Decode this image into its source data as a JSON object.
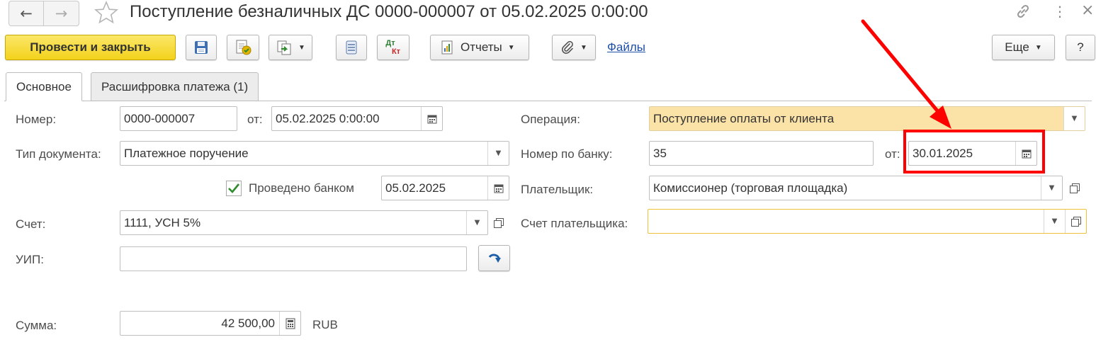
{
  "window": {
    "title": "Поступление безналичных ДС 0000-000007 от 05.02.2025 0:00:00",
    "link_glyph": "🔗",
    "more_glyph": "⋮",
    "close_glyph": "×"
  },
  "nav": {
    "back": "←",
    "forward": "→"
  },
  "toolbar": {
    "post_close": "Провести и закрыть",
    "reports": "Отчеты",
    "files": "Файлы",
    "more": "Еще",
    "help": "?",
    "dt": "Дт",
    "kt": "Кт"
  },
  "tabs": [
    {
      "label": "Основное",
      "active": true
    },
    {
      "label": "Расшифровка платежа (1)",
      "active": false
    }
  ],
  "form": {
    "number_label": "Номер:",
    "number_value": "0000-000007",
    "from_label": "от:",
    "date_value": "05.02.2025  0:00:00",
    "doc_type_label": "Тип документа:",
    "doc_type_value": "Платежное поручение",
    "posted_by_bank_label": "Проведено банком",
    "posted_by_bank_checked": true,
    "posted_by_bank_date": "05.02.2025",
    "account_label": "Счет:",
    "account_value": "1111, УСН 5%",
    "uip_label": "УИП:",
    "uip_value": "",
    "sum_label": "Сумма:",
    "sum_value": "42 500,00",
    "currency": "RUB",
    "operation_label": "Операция:",
    "operation_value": "Поступление оплаты от клиента",
    "bank_number_label": "Номер по банку:",
    "bank_number_value": "35",
    "bank_from_label": "от:",
    "bank_date_value": "30.01.2025",
    "payer_label": "Плательщик:",
    "payer_value": "Комиссионер (торговая площадка)",
    "payer_account_label": "Счет плательщика:",
    "payer_account_value": ""
  },
  "icons": {
    "dropdown": "▼",
    "calendar": "calendar-icon",
    "open": "open-in-window-icon",
    "save": "floppy-disk-icon",
    "post": "post-document-icon",
    "create_based": "create-based-on-icon",
    "list": "list-icon",
    "paperclip": "paperclip-icon",
    "fill": "fill-arrow-icon"
  },
  "colors": {
    "primary_button": "#f3d21c",
    "operation_highlight": "#fbe2a7",
    "focused_border": "#f0c23a",
    "annotation_red": "#ff0000",
    "link": "#1e4fa7"
  }
}
